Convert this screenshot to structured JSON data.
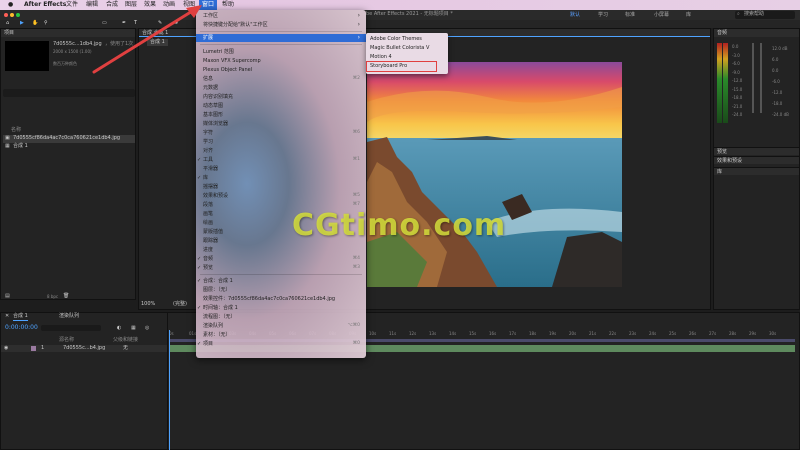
{
  "menubar": {
    "app_name": "After Effects",
    "items": [
      "文件",
      "编辑",
      "合成",
      "图层",
      "效果",
      "动画",
      "视图",
      "窗口",
      "帮助"
    ]
  },
  "window_title": "be After Effects 2021 - 无标题项目 *",
  "workspace_tabs": [
    "默认",
    "学习",
    "标准",
    "小屏幕",
    "库"
  ],
  "search": {
    "placeholder": "搜索帮助"
  },
  "project_panel": {
    "title": "项目",
    "file_name": "7d0555c...1db4.jpg",
    "file_used": "，使用了1次",
    "file_size": "2000 x 1500 (1.00)",
    "file_color": "数百万种颜色",
    "col_name": "名称",
    "items": [
      "7d0555cf86da4ac7c0ca760621ce1db4.jpg",
      "合成 1"
    ],
    "bpc": "8 bpc"
  },
  "comp_panel": {
    "tab_label": "合成 合成 1",
    "sub_tab": "合成 1",
    "zoom": "100%",
    "resolution": "(完整)"
  },
  "audio_panel": {
    "title": "音频",
    "db_right": [
      "12.0 dB",
      "6.0",
      "0.0",
      "-6.0",
      "-12.0",
      "-18.0",
      "-24.0 dB"
    ],
    "db_left": [
      "0.0",
      "-3.0",
      "-6.0",
      "-9.0",
      "-12.0",
      "-15.0",
      "-18.0",
      "-21.0",
      "-24.0"
    ]
  },
  "right_panels": [
    "预览",
    "效果和预设",
    "库"
  ],
  "timeline": {
    "tab_label": "合成 1",
    "render_queue": "渲染队列",
    "timecode": "0:00:00:00",
    "col_source": "源名称",
    "col_parent": "父级和链接",
    "layer_num": "1",
    "layer_name": "7d0555c...b4.jpg",
    "layer_parent": "无",
    "ruler": [
      "0s",
      "01s",
      "02s",
      "03s",
      "04s",
      "05s",
      "06s",
      "07s",
      "08s",
      "09s",
      "10s",
      "11s",
      "12s",
      "13s",
      "14s",
      "15s",
      "16s",
      "17s",
      "18s",
      "19s",
      "20s",
      "21s",
      "22s",
      "23s",
      "24s",
      "25s",
      "26s",
      "27s",
      "28s",
      "29s",
      "30s"
    ]
  },
  "window_menu": {
    "items": [
      {
        "label": "工作区",
        "arrow": "›"
      },
      {
        "label": "将快捷键分配给\"默认\"工作区",
        "arrow": "›"
      },
      {
        "label": "扩展",
        "arrow": "›",
        "highlighted": true
      },
      {
        "label": "Lumetri 范围"
      },
      {
        "label": "Maxon VFX Supercomp"
      },
      {
        "label": "Plexus Object Panel"
      },
      {
        "label": "信息",
        "shortcut": "⌘2"
      },
      {
        "label": "元数据"
      },
      {
        "label": "内容识别填充"
      },
      {
        "label": "动态草图"
      },
      {
        "label": "基本图形"
      },
      {
        "label": "媒体浏览器"
      },
      {
        "label": "字符",
        "shortcut": "⌘6"
      },
      {
        "label": "学习"
      },
      {
        "label": "对齐"
      },
      {
        "label": "工具",
        "shortcut": "⌘1",
        "checked": true
      },
      {
        "label": "平滑器"
      },
      {
        "label": "库",
        "checked": true
      },
      {
        "label": "摇摆器"
      },
      {
        "label": "效果和预设",
        "shortcut": "⌘5"
      },
      {
        "label": "段落",
        "shortcut": "⌘7"
      },
      {
        "label": "画笔"
      },
      {
        "label": "绘画"
      },
      {
        "label": "蒙版插值"
      },
      {
        "label": "跟踪器"
      },
      {
        "label": "进度"
      },
      {
        "label": "音频",
        "shortcut": "⌘4",
        "checked": true
      },
      {
        "label": "预览",
        "shortcut": "⌘3",
        "checked": true
      },
      {
        "label": "合成：合成 1",
        "checked": true
      },
      {
        "label": "图层：（无）"
      },
      {
        "label": "效果控件：7d0555cf86da4ac7c0ca760621ce1db4.jpg"
      },
      {
        "label": "时间轴：合成 1",
        "checked": true
      },
      {
        "label": "流程图：（无）"
      },
      {
        "label": "渲染队列",
        "shortcut": "⌥⌘0"
      },
      {
        "label": "素材：（无）"
      },
      {
        "label": "项目",
        "shortcut": "⌘0",
        "checked": true
      }
    ],
    "submenu": [
      "Adobe Color Themes",
      "Magic Bullet Colorista V",
      "Motion 4",
      "Storyboard Pro"
    ]
  },
  "watermark": "CGtimo.com",
  "colors": {
    "highlight": "#2f6cd6",
    "annotation": "#e04040",
    "timecode": "#4fa3ff"
  }
}
